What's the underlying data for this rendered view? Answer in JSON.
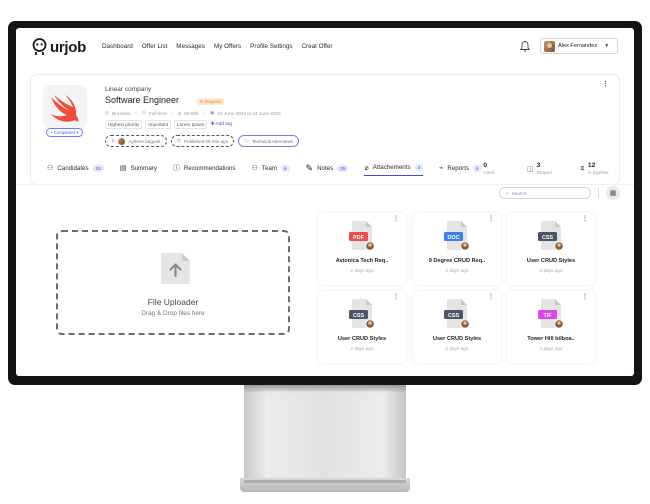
{
  "nav": {
    "logo_text": "urjob",
    "links": [
      "Dashboard",
      "Offer List",
      "Messages",
      "My Offers",
      "Profile Settings",
      "Creat Offer"
    ],
    "user_name": "Alex Fernandez"
  },
  "job": {
    "company": "Linear company",
    "title": "Software Engineer",
    "status_badge": "In Progress",
    "status_pill": "• Completed ▾",
    "location": "Brussels",
    "type": "Full-time",
    "salary": "50-55k",
    "dates": "24 June 2024 to 24 June 2025",
    "tags": [
      "Highest priority",
      "Important",
      "Lorem Ipsum"
    ],
    "add_tag": "Add tag",
    "chips": [
      "Ayrlene bagumt",
      "Published 06 min ago",
      "Technical Interviews"
    ],
    "stats": [
      {
        "num": "0",
        "label": "Hired"
      },
      {
        "num": "3",
        "label": "Droped"
      },
      {
        "num": "12",
        "label": "in pipeline"
      }
    ]
  },
  "tabs": [
    {
      "label": "Candidates",
      "count": "25"
    },
    {
      "label": "Summary",
      "count": ""
    },
    {
      "label": "Recommendations",
      "count": ""
    },
    {
      "label": "Team",
      "count": "6"
    },
    {
      "label": "Notes",
      "count": "25"
    },
    {
      "label": "Attachements",
      "count": "4"
    },
    {
      "label": "Reports",
      "count": "8"
    }
  ],
  "search": {
    "placeholder": "Search"
  },
  "uploader": {
    "title": "File Uploader",
    "subtitle": "Drag & Drop files here"
  },
  "files": [
    {
      "type": "PDF",
      "name": "Avionica Tech Req..",
      "time": "2 days ago",
      "color": "#ef4b4b"
    },
    {
      "type": "DOC",
      "name": "9 Degree CRUD Req..",
      "time": "2 days ago",
      "color": "#3b82f6"
    },
    {
      "type": "CSS",
      "name": "User CRUD Styles",
      "time": "2 days ago",
      "color": "#4b5563"
    },
    {
      "type": "CSS",
      "name": "User CRUD Styles",
      "time": "2 days ago",
      "color": "#4b5563"
    },
    {
      "type": "CSS",
      "name": "User CRUD Styles",
      "time": "2 days ago",
      "color": "#4b5563"
    },
    {
      "type": "TIF",
      "name": "Tower Hill bilboa..",
      "time": "2 days ago",
      "color": "#d946ef"
    }
  ],
  "colors": {
    "accent": "#4149d9",
    "swift": "#f04a3a"
  }
}
